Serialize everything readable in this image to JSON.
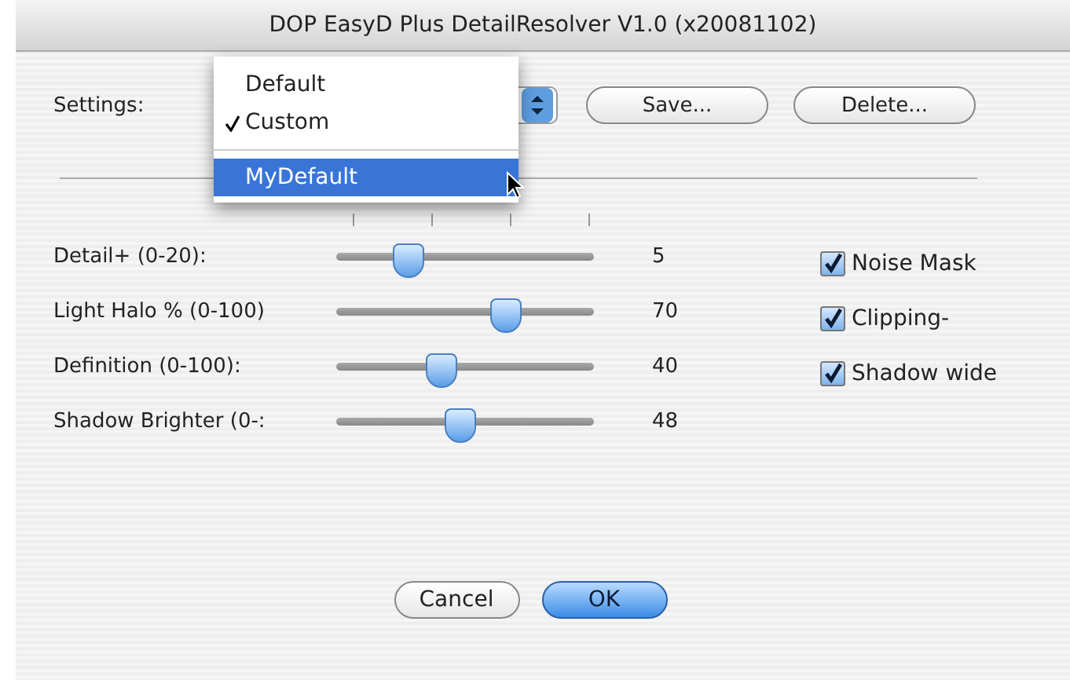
{
  "window": {
    "title": "DOP EasyD Plus DetailResolver V1.0 (x20081102)"
  },
  "settings": {
    "label": "Settings:",
    "menu": [
      {
        "label": "Default",
        "checked": false,
        "selected": false
      },
      {
        "label": "Custom",
        "checked": true,
        "selected": false
      },
      {
        "kind": "separator"
      },
      {
        "label": "MyDefault",
        "checked": false,
        "selected": true
      }
    ],
    "buttons": [
      {
        "label": "Save..."
      },
      {
        "label": "Delete..."
      }
    ]
  },
  "sliders": [
    {
      "label": "Detail+ (0-20):",
      "level": 0.28,
      "reading": "5"
    },
    {
      "label": "Light Halo % (0-100)",
      "level": 0.66,
      "reading": "70"
    },
    {
      "label": "Definition (0-100):",
      "level": 0.41,
      "reading": "40"
    },
    {
      "label": "Shadow Brighter (0-:",
      "level": 0.48,
      "reading": "48"
    }
  ],
  "options": [
    {
      "label": "Noise Mask",
      "checked": true
    },
    {
      "label": "Clipping-",
      "checked": true
    },
    {
      "label": "Shadow wide",
      "checked": true
    }
  ],
  "footer": [
    {
      "label": "Cancel",
      "default": false
    },
    {
      "label": "OK",
      "default": true
    }
  ]
}
